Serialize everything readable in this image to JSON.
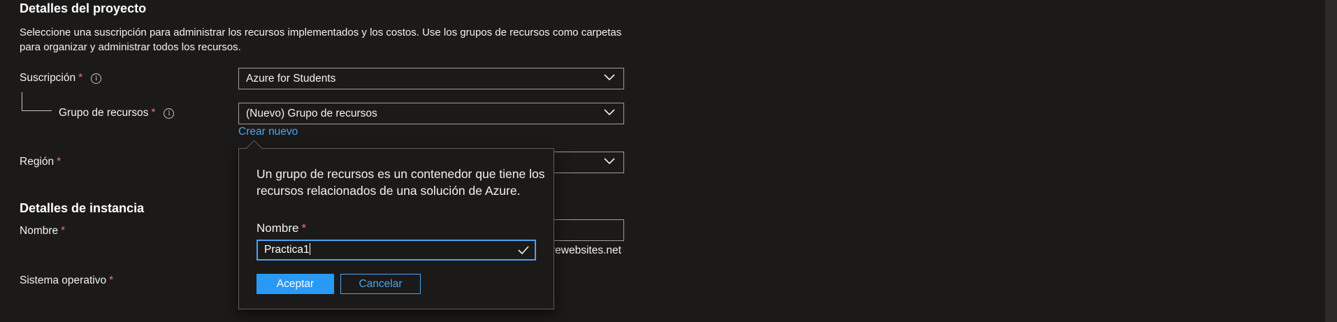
{
  "project_details": {
    "heading": "Detalles del proyecto",
    "description": "Seleccione una suscripción para administrar los recursos implementados y los costos. Use los grupos de recursos como carpetas para organizar y administrar todos los recursos.",
    "subscription": {
      "label": "Suscripción",
      "required_mark": "*",
      "value": "Azure for Students",
      "info_icon": "info-icon"
    },
    "resource_group": {
      "label": "Grupo de recursos",
      "required_mark": "*",
      "value": "(Nuevo) Grupo de recursos",
      "create_link": "Crear nuevo",
      "info_icon": "info-icon"
    },
    "region": {
      "label": "Región",
      "required_mark": "*"
    }
  },
  "instance_details": {
    "heading": "Detalles de instancia",
    "name": {
      "label": "Nombre",
      "required_mark": "*",
      "suffix": "rewebsites.net"
    },
    "os": {
      "label": "Sistema operativo",
      "required_mark": "*"
    }
  },
  "create_popup": {
    "description": "Un grupo de recursos es un contenedor que tiene los recursos relacionados de una solución de Azure.",
    "name_label": "Nombre",
    "required_mark": "*",
    "name_value": "Practica1",
    "ok_label": "Aceptar",
    "cancel_label": "Cancelar"
  },
  "colors": {
    "accent": "#2899f5",
    "link": "#4ba3f0",
    "required": "#f1707b",
    "background": "#1b1a19"
  }
}
